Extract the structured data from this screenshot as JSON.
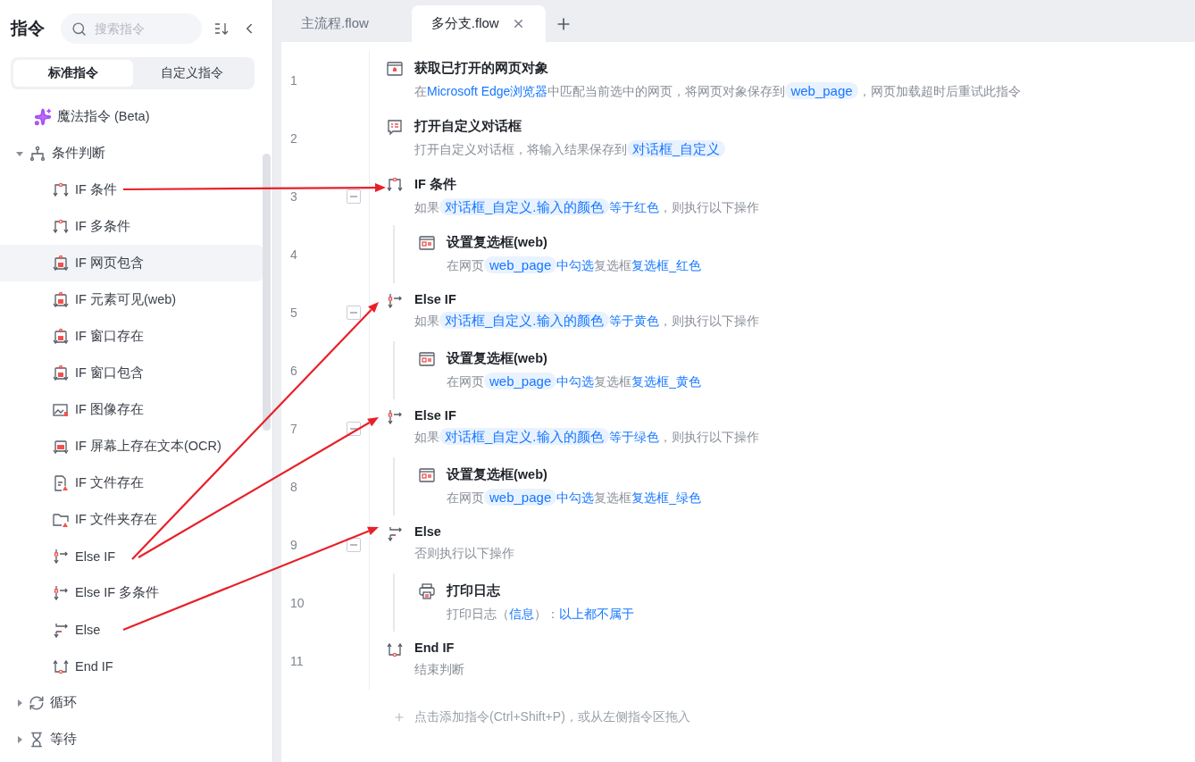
{
  "sidebar": {
    "title": "指令",
    "search": {
      "placeholder": "搜索指令"
    },
    "tabs": [
      {
        "label": "标准指令",
        "selected": true
      },
      {
        "label": "自定义指令",
        "selected": false
      }
    ],
    "items": [
      {
        "label": "魔法指令 (Beta)",
        "kind": "magic"
      },
      {
        "label": "条件判断",
        "kind": "branch",
        "expanded": true,
        "children": [
          {
            "label": "IF 条件",
            "kind": "if",
            "selected": false
          },
          {
            "label": "IF 多条件",
            "kind": "if",
            "selected": false
          },
          {
            "label": "IF 网页包含",
            "kind": "web-if",
            "selected": true
          },
          {
            "label": "IF 元素可见(web)",
            "kind": "web-if",
            "selected": false
          },
          {
            "label": "IF 窗口存在",
            "kind": "web-if",
            "selected": false
          },
          {
            "label": "IF 窗口包含",
            "kind": "web-if",
            "selected": false
          },
          {
            "label": "IF 图像存在",
            "kind": "image-if",
            "selected": false
          },
          {
            "label": "IF 屏幕上存在文本(OCR)",
            "kind": "ocr-if",
            "selected": false
          },
          {
            "label": "IF 文件存在",
            "kind": "file-if",
            "selected": false
          },
          {
            "label": "IF 文件夹存在",
            "kind": "folder-if",
            "selected": false
          },
          {
            "label": "Else IF",
            "kind": "else-if",
            "selected": false
          },
          {
            "label": "Else IF 多条件",
            "kind": "else-if",
            "selected": false
          },
          {
            "label": "Else",
            "kind": "else",
            "selected": false
          },
          {
            "label": "End IF",
            "kind": "end-if",
            "selected": false
          }
        ]
      },
      {
        "label": "循环",
        "kind": "loop",
        "expanded": false
      },
      {
        "label": "等待",
        "kind": "wait",
        "expanded": false
      }
    ]
  },
  "tabs": [
    {
      "label": "主流程.flow",
      "selected": false
    },
    {
      "label": "多分支.flow",
      "selected": true
    }
  ],
  "steps": [
    {
      "line": "1",
      "kind": "browser",
      "title": "获取已打开的网页对象",
      "description": [
        {
          "kind": "text",
          "text": "在"
        },
        {
          "kind": "link",
          "text": "Microsoft Edge浏览器"
        },
        {
          "kind": "text",
          "text": "中匹配当前选中的网页，将网页对象保存到"
        },
        {
          "kind": "pill",
          "text": "web_page"
        },
        {
          "kind": "text",
          "text": "，网页加载超时后重试此指令"
        }
      ]
    },
    {
      "line": "2",
      "kind": "dialog",
      "title": "打开自定义对话框",
      "description": [
        {
          "kind": "text",
          "text": "打开自定义对话框，将输入结果保存到"
        },
        {
          "kind": "pill",
          "text": "对话框_自定义"
        }
      ]
    },
    {
      "line": "3",
      "kind": "if",
      "title": "IF 条件",
      "expanded": true,
      "description": [
        {
          "kind": "text",
          "text": "如果"
        },
        {
          "kind": "pill",
          "text": "对话框_自定义.输入的颜色"
        },
        {
          "kind": "link",
          "text": "等于红色"
        },
        {
          "kind": "text",
          "text": "，则执行以下操作"
        }
      ],
      "children": [
        {
          "line": "4",
          "kind": "checkbox",
          "title": "设置复选框(web)",
          "description": [
            {
              "kind": "text",
              "text": "在网页"
            },
            {
              "kind": "pill",
              "text": "web_page"
            },
            {
              "kind": "link",
              "text": "中勾选"
            },
            {
              "kind": "text",
              "text": "复选框"
            },
            {
              "kind": "link",
              "text": "复选框_红色"
            }
          ]
        }
      ]
    },
    {
      "line": "5",
      "kind": "else-if",
      "title": "Else IF",
      "expanded": true,
      "description": [
        {
          "kind": "text",
          "text": "如果"
        },
        {
          "kind": "pill",
          "text": "对话框_自定义.输入的颜色"
        },
        {
          "kind": "link",
          "text": "等于黄色"
        },
        {
          "kind": "text",
          "text": "，则执行以下操作"
        }
      ],
      "children": [
        {
          "line": "6",
          "kind": "checkbox",
          "title": "设置复选框(web)",
          "description": [
            {
              "kind": "text",
              "text": "在网页"
            },
            {
              "kind": "pill",
              "text": "web_page"
            },
            {
              "kind": "link",
              "text": "中勾选"
            },
            {
              "kind": "text",
              "text": "复选框"
            },
            {
              "kind": "link",
              "text": "复选框_黄色"
            }
          ]
        }
      ]
    },
    {
      "line": "7",
      "kind": "else-if",
      "title": "Else IF",
      "expanded": true,
      "description": [
        {
          "kind": "text",
          "text": "如果"
        },
        {
          "kind": "pill",
          "text": "对话框_自定义.输入的颜色"
        },
        {
          "kind": "link",
          "text": "等于绿色"
        },
        {
          "kind": "text",
          "text": "，则执行以下操作"
        }
      ],
      "children": [
        {
          "line": "8",
          "kind": "checkbox",
          "title": "设置复选框(web)",
          "description": [
            {
              "kind": "text",
              "text": "在网页"
            },
            {
              "kind": "pill",
              "text": "web_page"
            },
            {
              "kind": "link",
              "text": "中勾选"
            },
            {
              "kind": "text",
              "text": "复选框"
            },
            {
              "kind": "link",
              "text": "复选框_绿色"
            }
          ]
        }
      ]
    },
    {
      "line": "9",
      "kind": "else",
      "title": "Else",
      "expanded": true,
      "description": [
        {
          "kind": "text",
          "text": "否则执行以下操作"
        }
      ],
      "children": [
        {
          "line": "10",
          "kind": "print",
          "title": "打印日志",
          "description": [
            {
              "kind": "text",
              "text": "打印日志（"
            },
            {
              "kind": "link",
              "text": "信息"
            },
            {
              "kind": "text",
              "text": "）："
            },
            {
              "kind": "link",
              "text": "以上都不属于"
            }
          ]
        }
      ]
    },
    {
      "line": "11",
      "kind": "end-if",
      "title": "End IF",
      "description": [
        {
          "kind": "text",
          "text": "结束判断"
        }
      ]
    }
  ],
  "add_hint": "点击添加指令(Ctrl+Shift+P)，或从左侧指令区拖入"
}
